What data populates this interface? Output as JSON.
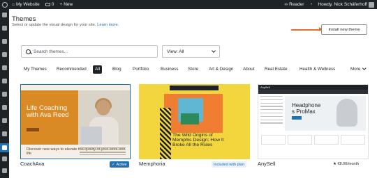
{
  "admin_bar": {
    "site_name": "My Website",
    "comments_count": "0",
    "new_label": "New",
    "reader_label": "Reader",
    "greeting": "Howdy, Nick Schäferhoff"
  },
  "header": {
    "title": "Themes",
    "subtitle": "Select or update the visual design for your site.",
    "learn_more": "Learn more.",
    "install_button": "Install new theme"
  },
  "search": {
    "placeholder": "Search themes...",
    "view_value": "View: All"
  },
  "tabs": [
    "My Themes",
    "Recommended",
    "All",
    "Blog",
    "Portfolio",
    "Business",
    "Store",
    "Art & Design",
    "About",
    "Real Estate",
    "Health & Wellness"
  ],
  "active_tab": "All",
  "more_label": "More",
  "themes": [
    {
      "name": "CoachAva",
      "badge": "Active",
      "preview_title": "Life Coaching with Ava Reed",
      "preview_tagline": "Discover new ways to elevate the quality of your work and life"
    },
    {
      "name": "Memphoria",
      "badge": "Included with plan",
      "preview_title": "The Wild Origins of Memphis Design: How It Broke All the Rules"
    },
    {
      "name": "AnySell",
      "price": "€8.00/month",
      "preview_logo": "AnySell",
      "preview_title": "Headphones ProMax"
    }
  ],
  "colors": {
    "admin_bg": "#1d2327",
    "accent": "#2271b1",
    "arrow": "#e26f2d",
    "coach_orange": "#d98a25",
    "memphoria_yellow": "#f3d63e"
  }
}
